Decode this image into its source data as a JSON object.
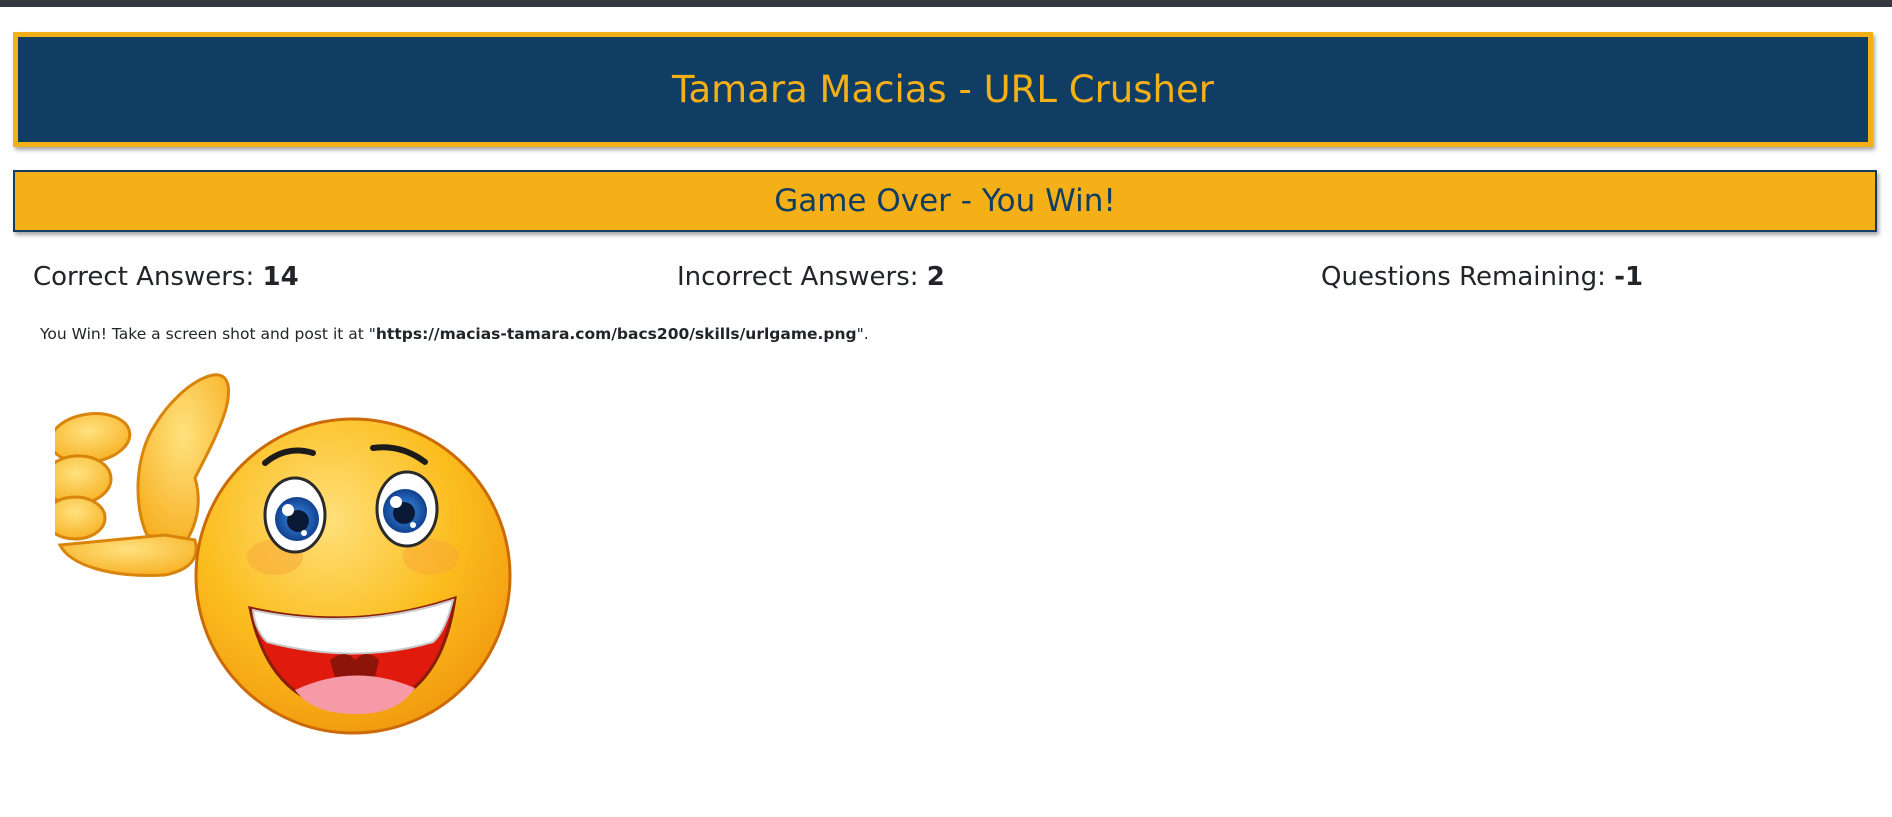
{
  "header": {
    "title": "Tamara Macias - URL Crusher"
  },
  "banner": {
    "status": "Game Over - You Win!"
  },
  "stats": {
    "correct_label": "Correct Answers: ",
    "correct_value": "14",
    "incorrect_label": "Incorrect Answers: ",
    "incorrect_value": "2",
    "remaining_label": "Questions Remaining: ",
    "remaining_value": "-1"
  },
  "message": {
    "prefix": "You Win! Take a screen shot and post it at \"",
    "url": "https://macias-tamara.com/bacs200/skills/urlgame.png",
    "suffix": "\"."
  },
  "image": {
    "icon": "thumbs-up-smiley-emoji"
  },
  "colors": {
    "navy": "#0f3d63",
    "gold": "#f5b018",
    "topbar": "#343a40"
  }
}
